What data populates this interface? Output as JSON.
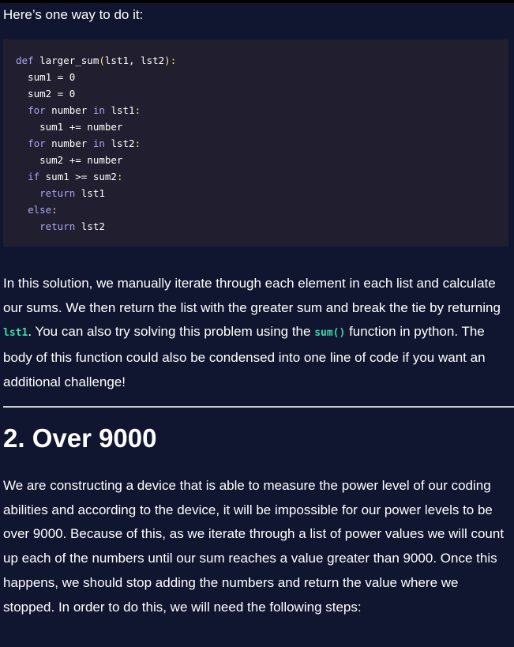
{
  "intro": "Here’s one way to do it:",
  "code": {
    "lines": [
      [
        {
          "t": "def",
          "c": "kw"
        },
        {
          "t": " larger_sum",
          "c": ""
        },
        {
          "t": "(",
          "c": "pn"
        },
        {
          "t": "lst1, lst2",
          "c": ""
        },
        {
          "t": "):",
          "c": "pn"
        }
      ],
      [
        {
          "t": "  sum1 = 0",
          "c": ""
        }
      ],
      [
        {
          "t": "  sum2 = 0",
          "c": ""
        }
      ],
      [
        {
          "t": "  ",
          "c": ""
        },
        {
          "t": "for",
          "c": "kw"
        },
        {
          "t": " number ",
          "c": ""
        },
        {
          "t": "in",
          "c": "kw"
        },
        {
          "t": " lst1",
          "c": ""
        },
        {
          "t": ":",
          "c": "pn"
        }
      ],
      [
        {
          "t": "    sum1 += number",
          "c": ""
        }
      ],
      [
        {
          "t": "  ",
          "c": ""
        },
        {
          "t": "for",
          "c": "kw"
        },
        {
          "t": " number ",
          "c": ""
        },
        {
          "t": "in",
          "c": "kw"
        },
        {
          "t": " lst2",
          "c": ""
        },
        {
          "t": ":",
          "c": "pn"
        }
      ],
      [
        {
          "t": "    sum2 += number",
          "c": ""
        }
      ],
      [
        {
          "t": "  ",
          "c": ""
        },
        {
          "t": "if",
          "c": "kw"
        },
        {
          "t": " sum1 >= sum2",
          "c": ""
        },
        {
          "t": ":",
          "c": "pn"
        }
      ],
      [
        {
          "t": "    ",
          "c": ""
        },
        {
          "t": "return",
          "c": "kw"
        },
        {
          "t": " lst1",
          "c": ""
        }
      ],
      [
        {
          "t": "  ",
          "c": ""
        },
        {
          "t": "else",
          "c": "kw"
        },
        {
          "t": ":",
          "c": "pn"
        }
      ],
      [
        {
          "t": "    ",
          "c": ""
        },
        {
          "t": "return",
          "c": "kw"
        },
        {
          "t": " lst2",
          "c": ""
        }
      ]
    ]
  },
  "solution": {
    "part1": "In this solution, we manually iterate through each element in each list and calculate our sums. We then return the list with the greater sum and break the tie by returning ",
    "code1": "lst1",
    "part2": ". You can also try solving this problem using the ",
    "code2": "sum()",
    "part3": " function in python. The body of this function could also be condensed into one line of code if you want an additional challenge!"
  },
  "section": {
    "heading": "2. Over 9000",
    "body": "We are constructing a device that is able to measure the power level of our coding abilities and according to the device, it will be impossible for our power levels to be over 9000. Because of this, as we iterate through a list of power values we will count up each of the numbers until our sum reaches a value greater than 9000. Once this happens, we should stop adding the numbers and return the value where we stopped. In order to do this, we will need the following steps:"
  },
  "colors": {
    "page_bg": "#10162f",
    "code_bg": "#211e2f",
    "keyword": "#a7a7f5",
    "punctuation": "#fde876",
    "inline_code": "#3dd8a8",
    "rule": "#c8c9d1"
  }
}
